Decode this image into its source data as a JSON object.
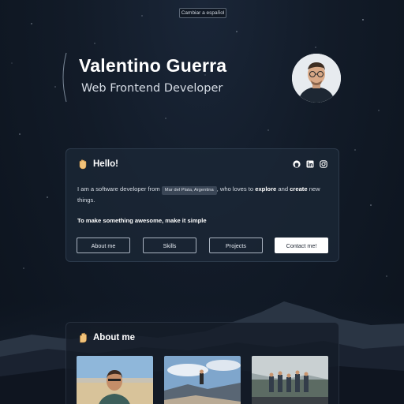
{
  "lang_toggle": "Cambiar a español",
  "header": {
    "name": "Valentino Guerra",
    "role": "Web Frontend Developer"
  },
  "hello": {
    "title": "Hello!",
    "intro_prefix": "I am a software developer from",
    "location": "Mar del Plata, Argentina",
    "intro_middle": ", who loves to",
    "explore": "explore",
    "and": "and",
    "create": "create",
    "intro_suffix": "new things.",
    "motto": "To make something awesome, make it simple",
    "socials": [
      "github-icon",
      "linkedin-icon",
      "instagram-icon"
    ],
    "buttons": {
      "about": "About me",
      "skills": "Skills",
      "projects": "Projects",
      "contact": "Contact me!"
    }
  },
  "about": {
    "title": "About me"
  }
}
